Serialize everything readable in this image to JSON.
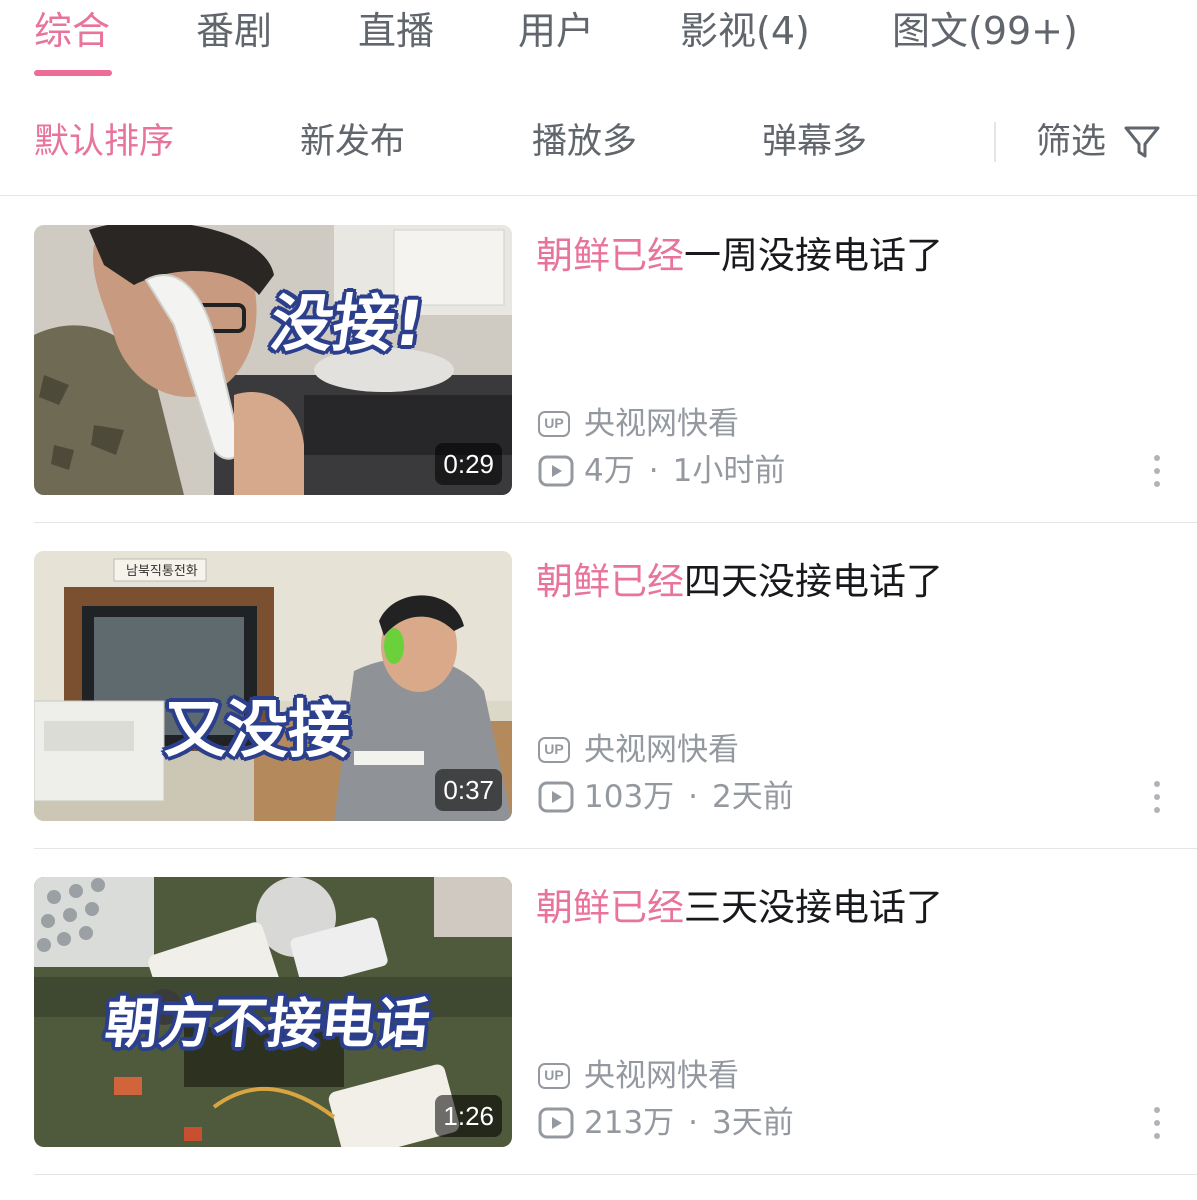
{
  "tabs": [
    {
      "label": "综合",
      "active": true
    },
    {
      "label": "番剧",
      "active": false
    },
    {
      "label": "直播",
      "active": false
    },
    {
      "label": "用户",
      "active": false
    },
    {
      "label": "影视(4)",
      "active": false
    },
    {
      "label": "图文(99+)",
      "active": false
    }
  ],
  "sort": {
    "options": [
      "默认排序",
      "新发布",
      "播放多",
      "弹幕多"
    ],
    "active": "默认排序",
    "filter_label": "筛选",
    "filter_icon": "funnel-icon"
  },
  "colors": {
    "accent": "#e8739b",
    "text": "#18191c",
    "secondary": "#61666d",
    "meta": "#9499a0"
  },
  "videos": [
    {
      "title_highlight": "朝鲜已经",
      "title_rest": "一周没接电话了",
      "thumb_caption": "没接!",
      "duration": "0:29",
      "uploader": "央视网快看",
      "up_badge": "UP",
      "views": "4万",
      "time": "1小时前"
    },
    {
      "title_highlight": "朝鲜已经",
      "title_rest": "四天没接电话了",
      "thumb_caption": "又没接",
      "thumb_sign": "남북직통전화",
      "duration": "0:37",
      "uploader": "央视网快看",
      "up_badge": "UP",
      "views": "103万",
      "time": "2天前"
    },
    {
      "title_highlight": "朝鲜已经",
      "title_rest": "三天没接电话了",
      "thumb_caption": "朝方不接电话",
      "duration": "1:26",
      "uploader": "央视网快看",
      "up_badge": "UP",
      "views": "213万",
      "time": "3天前"
    }
  ]
}
